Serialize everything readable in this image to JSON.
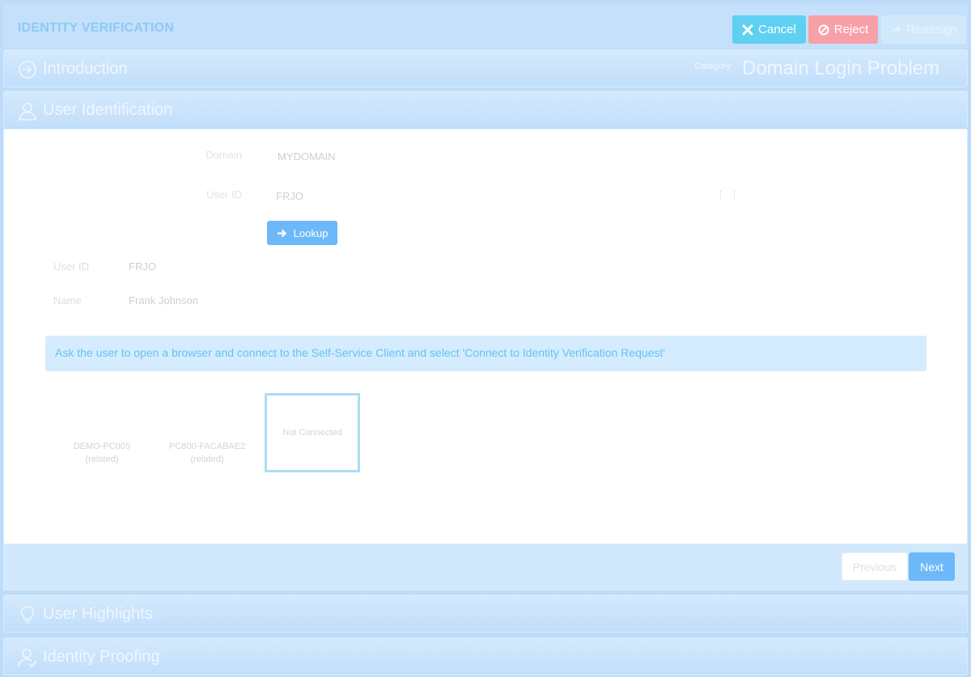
{
  "app": {
    "title": "IDENTITY VERIFICATION"
  },
  "toolbar": {
    "cancel_label": "Cancel",
    "cancel_icon": "close-icon",
    "reject_label": "Reject",
    "reject_icon": "ban-icon",
    "reassign_label": "Reassign",
    "reassign_icon": "share-arrow-icon"
  },
  "sections": {
    "introduction": {
      "title": "Introduction",
      "icon": "sign-in-icon",
      "category_label": "Category",
      "category_value": "Domain Login Problem"
    },
    "user_identification": {
      "title": "User Identification",
      "icon": "user-icon"
    },
    "user_highlights": {
      "title": "User Highlights",
      "icon": "lightbulb-icon"
    },
    "identity_proofing": {
      "title": "Identity Proofing",
      "icon": "user-check-icon"
    }
  },
  "form": {
    "domain_label": "Domain",
    "domain_value": "MYDOMAIN",
    "userid_label": "User ID",
    "userid_value": "FRJO",
    "lookup_label": "Lookup"
  },
  "user_info": {
    "userid_label": "User ID",
    "userid_value": "FRJO",
    "name_label": "Name",
    "name_value": "Frank Johnson"
  },
  "alert": {
    "text": "Ask the user to open a browser and connect to the Self-Service Client and select 'Connect to Identity Verification Request'"
  },
  "devices": [
    {
      "name": "DEMO-PC005",
      "status": "(related)"
    },
    {
      "name": "PC800-FACABAE2",
      "status": "(related)"
    }
  ],
  "connection": {
    "status": "Not Connected"
  },
  "footer": {
    "previous_label": "Previous",
    "next_label": "Next"
  },
  "colors": {
    "background": "#bcdcfa",
    "cancel": "#5fd0f2",
    "reject": "#f8a0a8",
    "primary": "#6db8f8",
    "alert_bg": "#d4ecfd",
    "alert_text": "#66c3f0"
  }
}
